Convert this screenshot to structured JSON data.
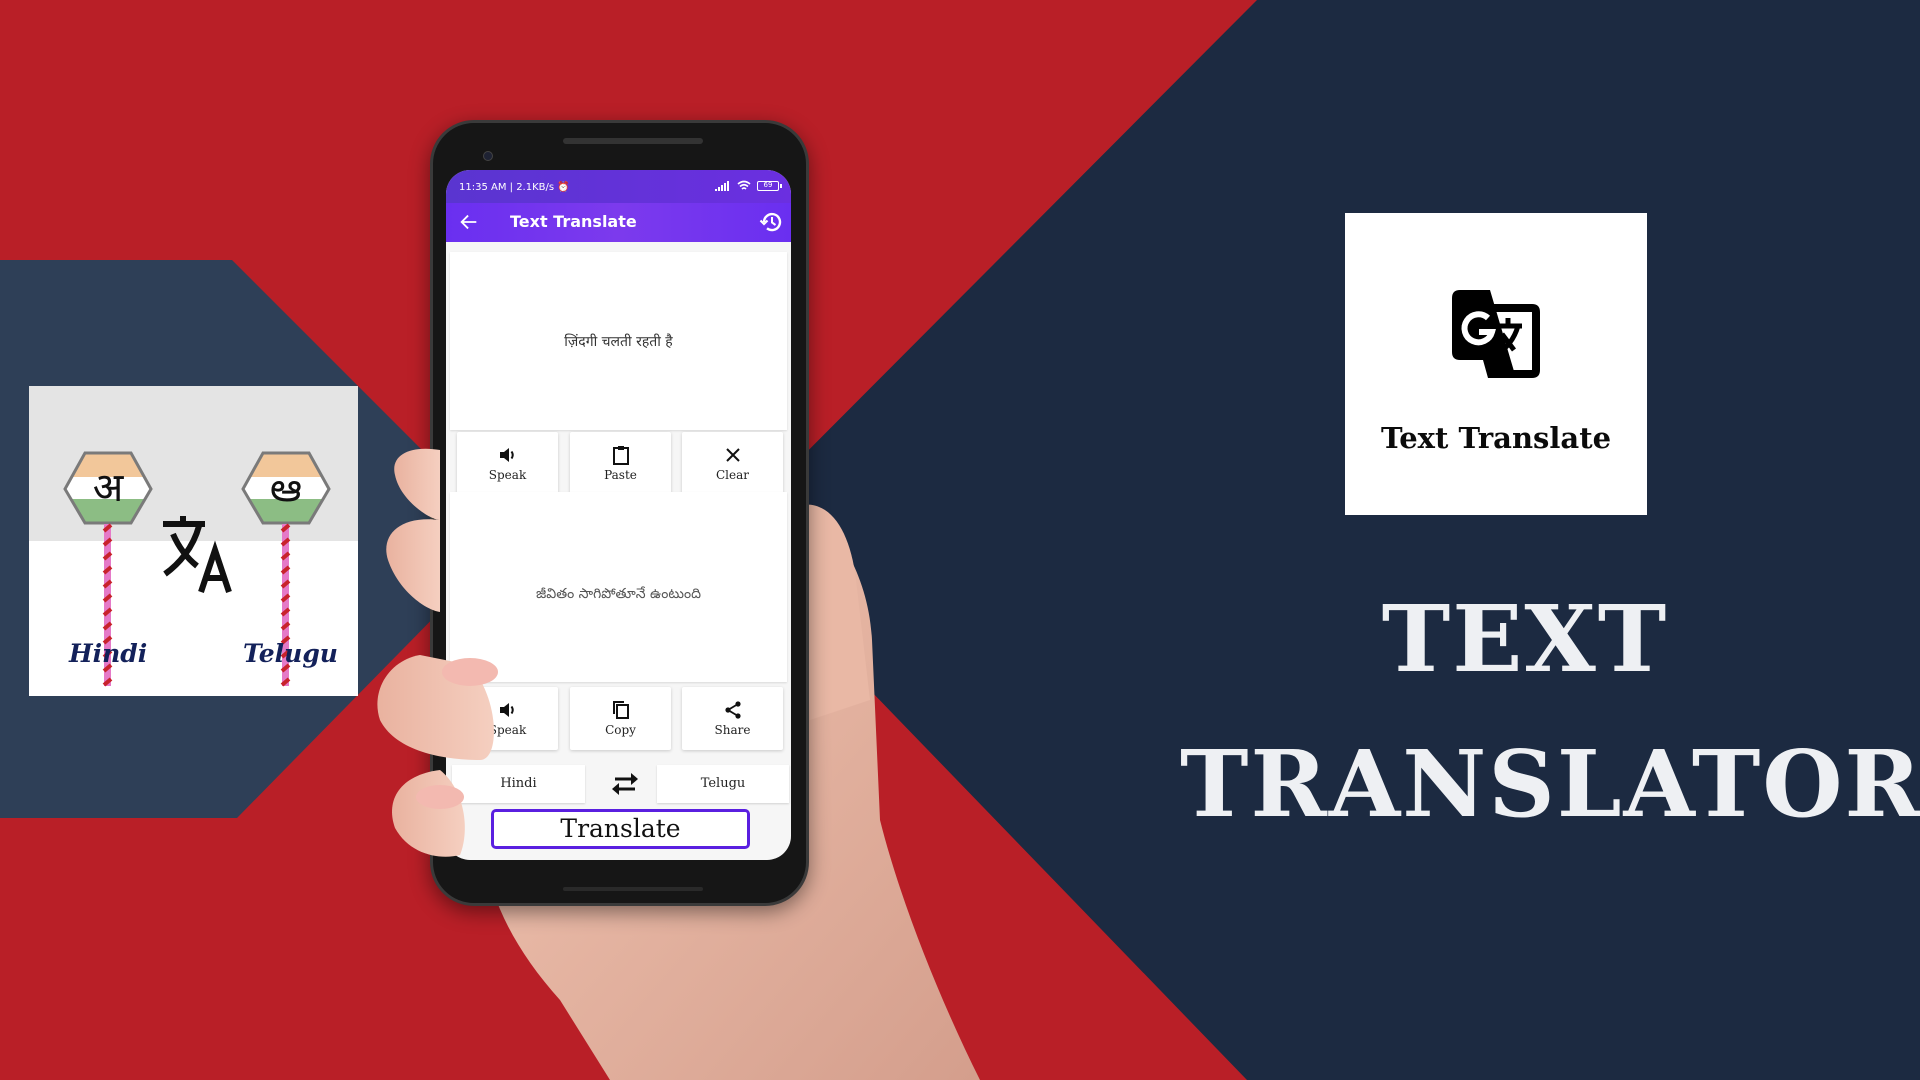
{
  "colors": {
    "background_red": "#b91f27",
    "navy_right": "#1c2a41",
    "navy_left": "#2e3f57",
    "appbar_purple": "#7c3aed",
    "translate_border": "#5a1fe0"
  },
  "left_card": {
    "source_glyph": "अ",
    "target_glyph": "ఆ",
    "source_label": "Hindi",
    "target_label": "Telugu",
    "icon": "translate-icon"
  },
  "right_card": {
    "icon": "google-translate-icon",
    "app_name": "Text Translate"
  },
  "hero": {
    "line1": "TEXT",
    "line2": "TRANSLATOR"
  },
  "phone": {
    "status_bar": {
      "time_and_speed": "11:35 AM | 2.1KB/s",
      "alarm_icon": "alarm-icon",
      "signal_icon": "signal-icon",
      "wifi_icon": "wifi-icon",
      "battery_level": "69"
    },
    "appbar": {
      "back_icon": "arrow-left-icon",
      "title": "Text Translate",
      "history_icon": "history-icon"
    },
    "source_text": "ज़िंदगी चलती रहती है",
    "source_actions": [
      {
        "icon": "speaker-icon",
        "label": "Speak"
      },
      {
        "icon": "clipboard-icon",
        "label": "Paste"
      },
      {
        "icon": "close-icon",
        "label": "Clear"
      }
    ],
    "translated_text": "జీవితం సాగిపోతూనే ఉంటుంది",
    "result_actions": [
      {
        "icon": "speaker-icon",
        "label": "Speak"
      },
      {
        "icon": "copy-icon",
        "label": "Copy"
      },
      {
        "icon": "share-icon",
        "label": "Share"
      }
    ],
    "from_language": "Hindi",
    "to_language": "Telugu",
    "swap_icon": "swap-arrows-icon",
    "translate_button": "Translate"
  }
}
